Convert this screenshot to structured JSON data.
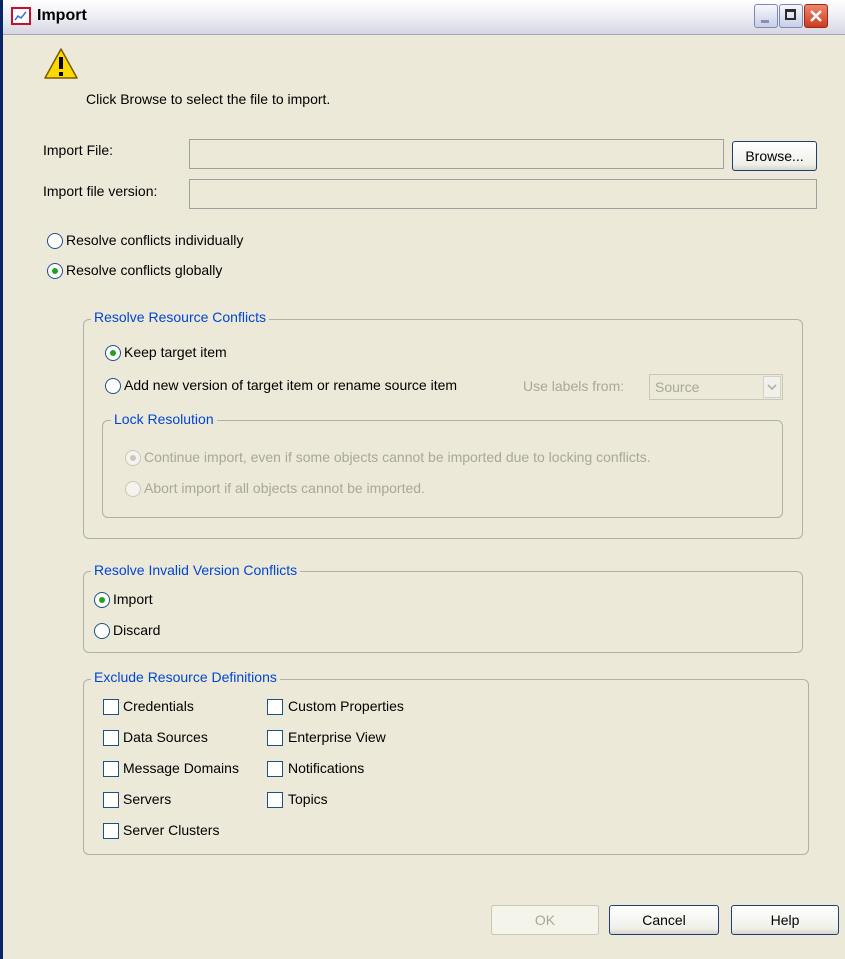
{
  "window": {
    "title": "Import"
  },
  "instruction": "Click Browse to select the file to import.",
  "import_file": {
    "label": "Import File:",
    "value": "",
    "browse_label": "Browse..."
  },
  "import_version": {
    "label": "Import file version:",
    "value": ""
  },
  "conflict_mode": {
    "individually": "Resolve conflicts individually",
    "globally": "Resolve conflicts globally",
    "selected": "globally"
  },
  "resource_conflicts": {
    "legend": "Resolve Resource Conflicts",
    "keep_target": "Keep target item",
    "add_new_version": "Add new version of target item or rename source item",
    "use_labels_from_label": "Use labels from:",
    "use_labels_from_value": "Source",
    "selected": "keep_target",
    "lock_resolution": {
      "legend": "Lock Resolution",
      "continue": "Continue import, even if some objects cannot be imported due to locking conflicts.",
      "abort": "Abort import if all objects cannot be imported.",
      "selected": "continue"
    }
  },
  "version_conflicts": {
    "legend": "Resolve Invalid Version Conflicts",
    "import": "Import",
    "discard": "Discard",
    "selected": "import"
  },
  "exclude_definitions": {
    "legend": "Exclude Resource Definitions",
    "left": [
      "Credentials",
      "Data Sources",
      "Message Domains",
      "Servers",
      "Server Clusters"
    ],
    "right": [
      "Custom Properties",
      "Enterprise View",
      "Notifications",
      "Topics"
    ]
  },
  "footer": {
    "ok": "OK",
    "cancel": "Cancel",
    "help": "Help"
  },
  "colors": {
    "legend": "#0046d5",
    "radio_dot": "#21a121",
    "window_bg": "#ece9d8"
  }
}
